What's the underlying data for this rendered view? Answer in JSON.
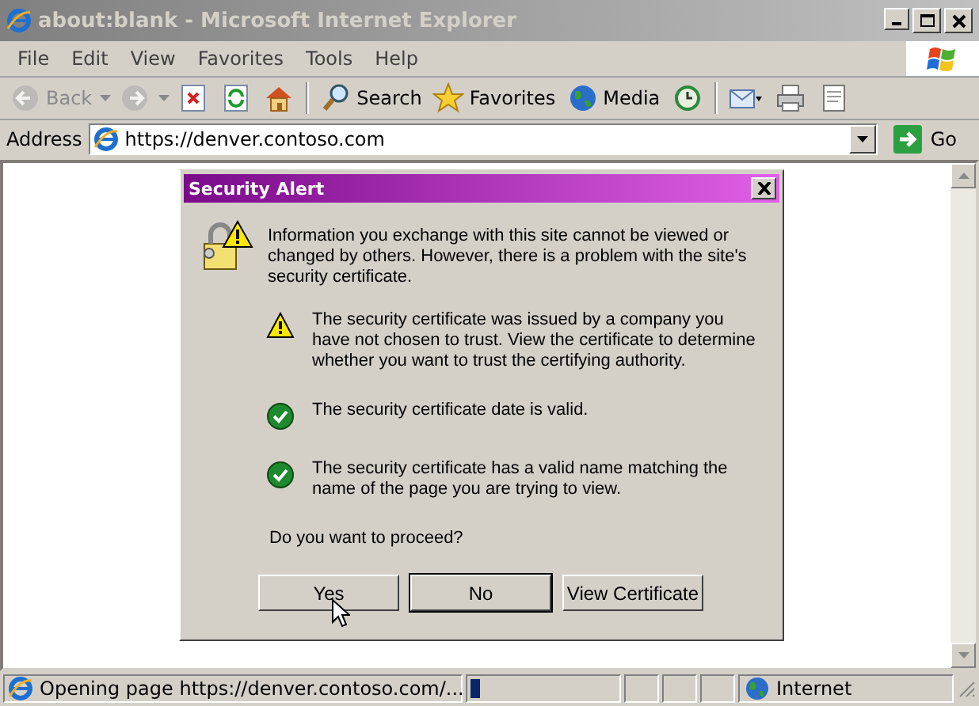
{
  "window": {
    "title": "about:blank - Microsoft Internet Explorer",
    "active": false
  },
  "menu": [
    "File",
    "Edit",
    "View",
    "Favorites",
    "Tools",
    "Help"
  ],
  "toolbar": [
    {
      "kind": "back",
      "label": "Back",
      "disabled": true
    },
    {
      "kind": "forward",
      "disabled": true
    },
    {
      "kind": "stop",
      "disabled": false
    },
    {
      "kind": "refresh",
      "disabled": false
    },
    {
      "kind": "home",
      "disabled": false
    },
    {
      "kind": "search",
      "label": "Search",
      "disabled": false
    },
    {
      "kind": "favorites",
      "label": "Favorites",
      "disabled": false
    },
    {
      "kind": "media",
      "label": "Media",
      "disabled": false
    },
    {
      "kind": "history",
      "disabled": false
    },
    {
      "kind": "mail",
      "disabled": false
    },
    {
      "kind": "print",
      "disabled": false
    },
    {
      "kind": "edit",
      "disabled": false
    }
  ],
  "address": {
    "label": "Address",
    "value": "https://denver.contoso.com",
    "go": "Go"
  },
  "dialog": {
    "title": "Security Alert",
    "intro": "Information you exchange with this site cannot be viewed or changed by others. However, there is a problem with the site's security certificate.",
    "checks": [
      {
        "kind": "warning",
        "text": "The security certificate was issued by a company you have not chosen to trust. View the certificate to determine whether you want to trust the certifying authority."
      },
      {
        "kind": "ok",
        "text": "The security certificate date is valid."
      },
      {
        "kind": "ok",
        "text": "The security certificate has a valid name matching the name of the page you are trying to view."
      }
    ],
    "question": "Do you want to proceed?",
    "buttons": [
      {
        "label": "Yes",
        "default": false
      },
      {
        "label": "No",
        "default": true
      },
      {
        "label": "View Certificate",
        "default": false
      }
    ]
  },
  "status_bar": {
    "text": "Opening page https://denver.contoso.com/...",
    "progress": {
      "level": 0.06
    },
    "zone": "Internet"
  }
}
